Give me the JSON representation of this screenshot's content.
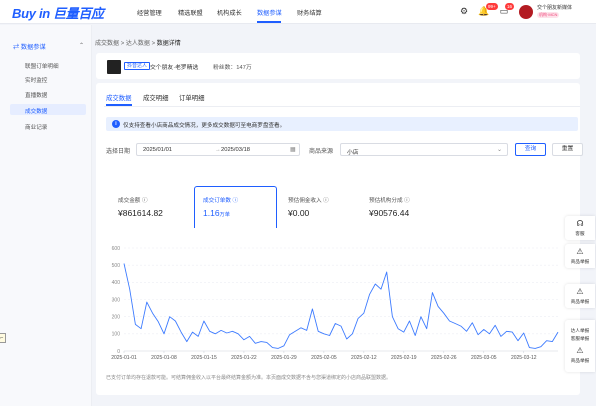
{
  "brand": {
    "logo_en": "Buy in",
    "logo_cn": "巨量百应"
  },
  "nav": {
    "items": [
      "经营管理",
      "精选联盟",
      "机构成长",
      "数据参谋",
      "财务结算"
    ],
    "active_index": 3
  },
  "header": {
    "messages_badge": "99+",
    "notify_badge": "16",
    "user_name": "交个朋友新媒体",
    "user_tag": "机构·MCN"
  },
  "sidebar": {
    "section": "数据参谋",
    "items": [
      "联盟订单明细",
      "实时监控",
      "直播数据",
      "成交数据",
      "商业记录"
    ],
    "selected_index": 3
  },
  "breadcrumb": {
    "l1": "成交数据",
    "l2": "达人数据",
    "l3": "数据详情",
    "sep": ">"
  },
  "shop": {
    "tag": "抖音达人",
    "name": "交个朋友·老罗精选",
    "fans": "粉丝数：147万"
  },
  "tabs": [
    "成交数据",
    "成交明细",
    "订单明细"
  ],
  "active_tab": 0,
  "notice": "仅支持查看小店商品成交情况，更多成交数据可至电商罗盘查看。",
  "filter": {
    "date_label": "选择日期",
    "date_start": "2025/01/01",
    "date_sep": "→",
    "date_end": "2025/03/18",
    "source_label": "商品来源",
    "source_value": "小店",
    "query_button": "查询",
    "reset_button": "重置"
  },
  "metrics": [
    {
      "label": "成交金额",
      "value": "¥861614.82",
      "unit": ""
    },
    {
      "label": "成交订单数",
      "value": "1.16",
      "unit": "万单"
    },
    {
      "label": "预估佣金收入",
      "value": "¥0.00",
      "unit": ""
    },
    {
      "label": "预估机构分成",
      "value": "¥90576.44",
      "unit": ""
    }
  ],
  "active_metric": 1,
  "float_bar": {
    "items": [
      "客服",
      "商品举报",
      "商品举报",
      "达人举报",
      "商品举报",
      "客服举报"
    ]
  },
  "footer_note": "已支付订单均存在退款可能。可结算佣金收入以平台最终结算金额为准。本页面成交数据不含与您渠道绑定的小店商品联盟数据。",
  "colors": {
    "accent": "#1f5eff",
    "line": "#3d7bff",
    "badge": "#ff3b3b"
  },
  "chart_data": {
    "type": "line",
    "ylim": [
      0,
      600
    ],
    "yticks": [
      0,
      100,
      200,
      300,
      400,
      500,
      600
    ],
    "xtick_labels": [
      "2025-01-01",
      "2025-01-08",
      "2025-01-15",
      "2025-01-22",
      "2025-01-29",
      "2025-02-05",
      "2025-02-12",
      "2025-02-19",
      "2025-02-26",
      "2025-03-05",
      "2025-03-12"
    ],
    "x": [
      "2025-01-01",
      "2025-01-02",
      "2025-01-03",
      "2025-01-04",
      "2025-01-05",
      "2025-01-06",
      "2025-01-07",
      "2025-01-08",
      "2025-01-09",
      "2025-01-10",
      "2025-01-11",
      "2025-01-12",
      "2025-01-13",
      "2025-01-14",
      "2025-01-15",
      "2025-01-16",
      "2025-01-17",
      "2025-01-18",
      "2025-01-19",
      "2025-01-20",
      "2025-01-21",
      "2025-01-22",
      "2025-01-23",
      "2025-01-24",
      "2025-01-25",
      "2025-01-26",
      "2025-01-27",
      "2025-01-28",
      "2025-01-29",
      "2025-01-30",
      "2025-01-31",
      "2025-02-01",
      "2025-02-02",
      "2025-02-03",
      "2025-02-04",
      "2025-02-05",
      "2025-02-06",
      "2025-02-07",
      "2025-02-08",
      "2025-02-09",
      "2025-02-10",
      "2025-02-11",
      "2025-02-12",
      "2025-02-13",
      "2025-02-14",
      "2025-02-15",
      "2025-02-16",
      "2025-02-17",
      "2025-02-18",
      "2025-02-19",
      "2025-02-20",
      "2025-02-21",
      "2025-02-22",
      "2025-02-23",
      "2025-02-24",
      "2025-02-25",
      "2025-02-26",
      "2025-02-27",
      "2025-02-28",
      "2025-03-01",
      "2025-03-02",
      "2025-03-03",
      "2025-03-04",
      "2025-03-05",
      "2025-03-06",
      "2025-03-07",
      "2025-03-08",
      "2025-03-09",
      "2025-03-10",
      "2025-03-11",
      "2025-03-12",
      "2025-03-13",
      "2025-03-14",
      "2025-03-15",
      "2025-03-16",
      "2025-03-17",
      "2025-03-18"
    ],
    "series": [
      {
        "values": [
          510,
          360,
          155,
          130,
          285,
          220,
          170,
          100,
          200,
          175,
          110,
          55,
          110,
          85,
          175,
          115,
          100,
          120,
          105,
          115,
          100,
          65,
          85,
          45,
          55,
          50,
          20,
          15,
          30,
          95,
          115,
          135,
          120,
          245,
          115,
          100,
          90,
          160,
          145,
          70,
          100,
          190,
          220,
          330,
          390,
          360,
          460,
          200,
          130,
          110,
          175,
          90,
          200,
          130,
          340,
          260,
          220,
          175,
          160,
          145,
          115,
          165,
          95,
          125,
          100,
          150,
          85,
          115,
          110,
          60,
          105,
          20,
          15,
          25,
          60,
          55,
          110
        ]
      }
    ]
  }
}
